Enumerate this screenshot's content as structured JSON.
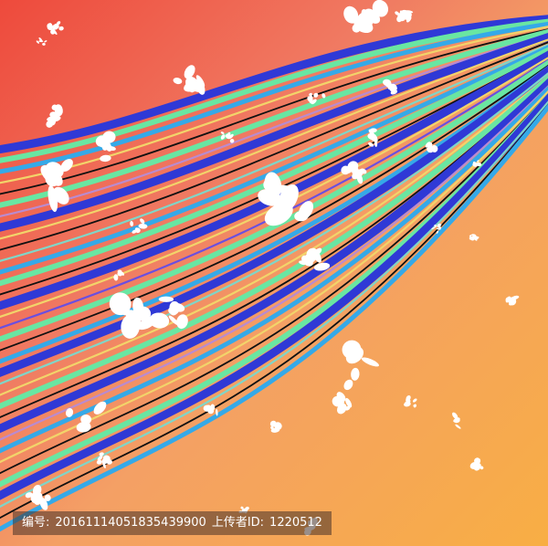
{
  "scene": {
    "description_colors": {
      "top_left": "#ee4a3c",
      "middle": "#f2a07a",
      "bottom_right": "#f7ad45"
    },
    "stripe_colors": [
      "#2f39d6",
      "#69e6a2",
      "#35a9e8",
      "#f2d46a",
      "#111111",
      "#b98bd0",
      "#7fd6c8",
      "#6a4fe0"
    ],
    "splatter_color": "#ffffff"
  },
  "caption": {
    "id_label": "编号:",
    "id_value": "20161114051835439900",
    "uploader_label": "上传者ID:",
    "uploader_value": "1220512"
  }
}
